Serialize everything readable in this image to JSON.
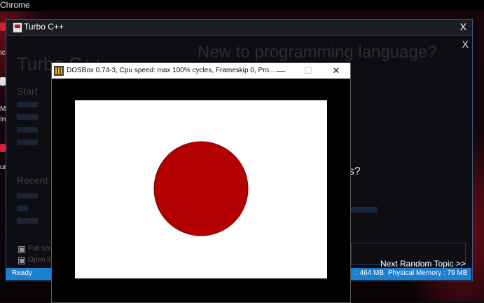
{
  "desktop": {
    "top_text": "Chrome",
    "icon_labels": [
      "Ic",
      "M",
      "In",
      "ur"
    ]
  },
  "turbo": {
    "title": "Turbo C++",
    "close": "X",
    "inner_close": "X",
    "brand": "Turbo C++",
    "headline": "New to programming language?",
    "start_label": "Start",
    "recent_label": "Recent",
    "question": "os?",
    "checkbox_1": "Full scr",
    "checkbox_2": "Open th",
    "next_link": "Next Random Topic >>",
    "status": {
      "ready": "Ready",
      "memory_1": ": 464 MB",
      "memory_2": "Physical Memory : 79 MB"
    }
  },
  "dosbox": {
    "title": "DOSBox 0.74-3, Cpu speed: max 100% cycles, Frameskip 0, Pro...",
    "minimize": "—",
    "maximize": "☐",
    "close": "✕"
  },
  "graphic": {
    "background_color": "#ffffff",
    "circle_color": "#b30000",
    "circle_outline": "#7a0000"
  }
}
